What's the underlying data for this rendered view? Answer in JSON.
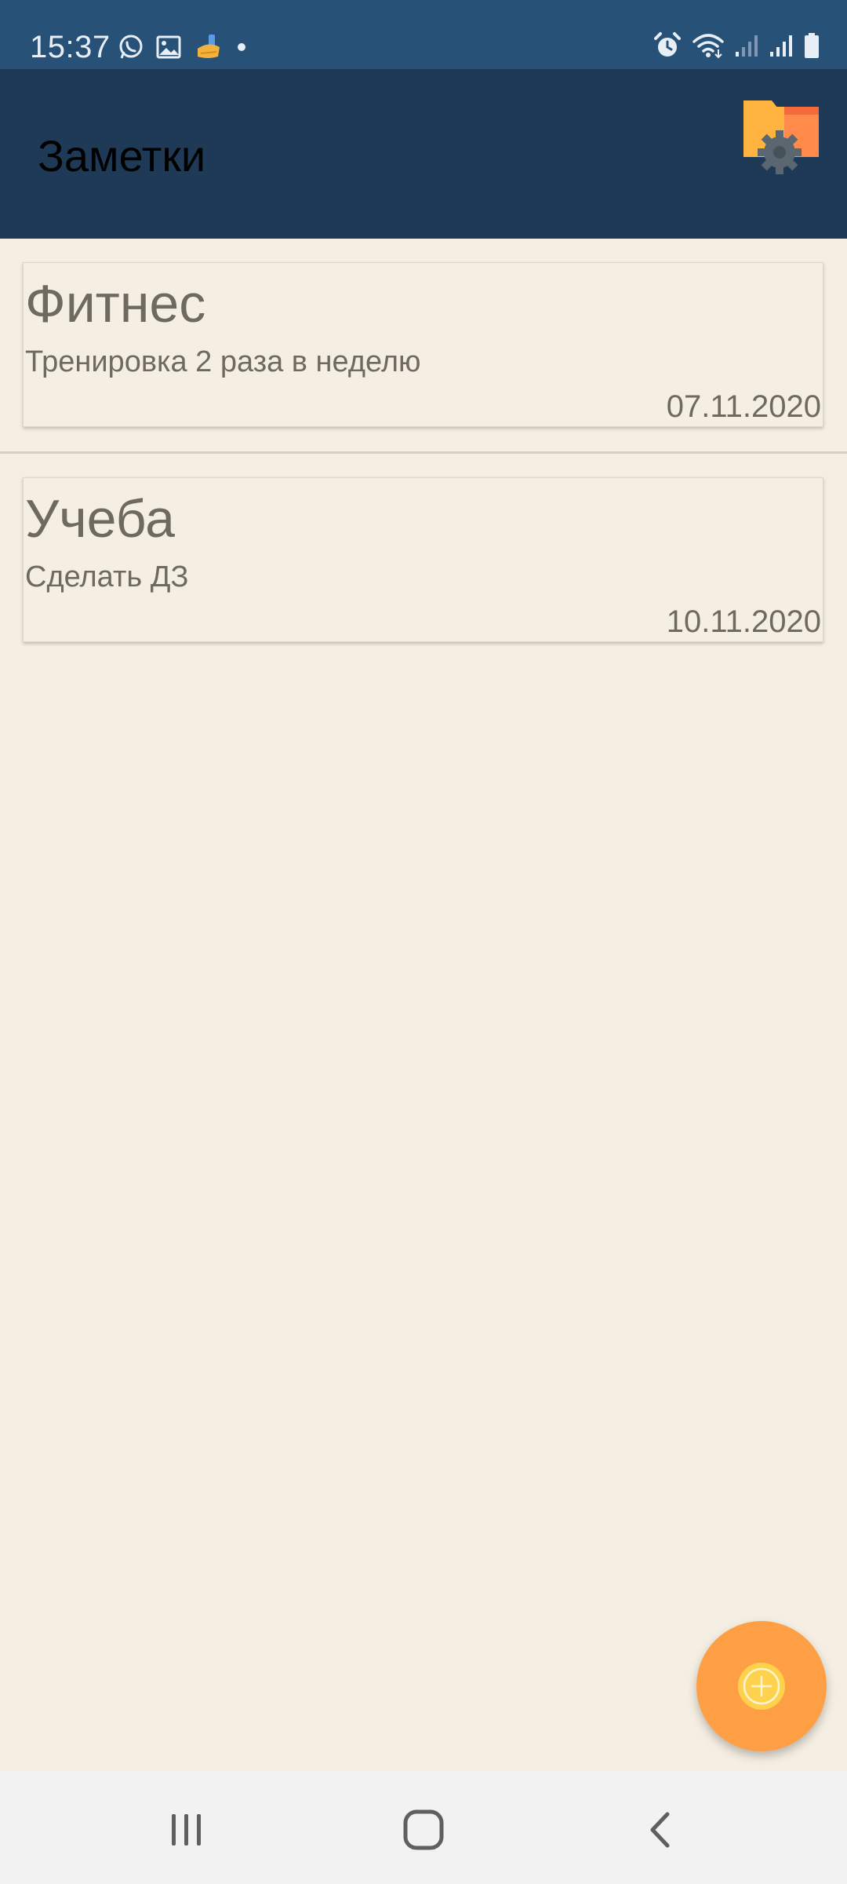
{
  "status_bar": {
    "time": "15:37",
    "icons_left": [
      "whatsapp-icon",
      "gallery-icon",
      "cleaner-icon",
      "notification-dot-icon"
    ],
    "icons_right": [
      "alarm-icon",
      "wifi-icon",
      "signal-icon",
      "signal-icon",
      "battery-icon"
    ]
  },
  "app_bar": {
    "title": "Заметки",
    "action_icon": "folder-settings-icon"
  },
  "notes": [
    {
      "title": "Фитнес",
      "text": "Тренировка 2 раза в неделю",
      "date": "07.11.2020"
    },
    {
      "title": "Учеба",
      "text": "Сделать ДЗ",
      "date": "10.11.2020"
    }
  ],
  "fab": {
    "icon": "add-icon"
  },
  "nav_bar": {
    "buttons": [
      "recent-apps-icon",
      "home-icon",
      "back-icon"
    ]
  },
  "colors": {
    "status_bar": "#285178",
    "app_bar": "#1E3A56",
    "background": "#F5EFE3",
    "text": "#6E6A60",
    "fab": "#FF9F45",
    "nav_bar": "#F2F2F2"
  }
}
